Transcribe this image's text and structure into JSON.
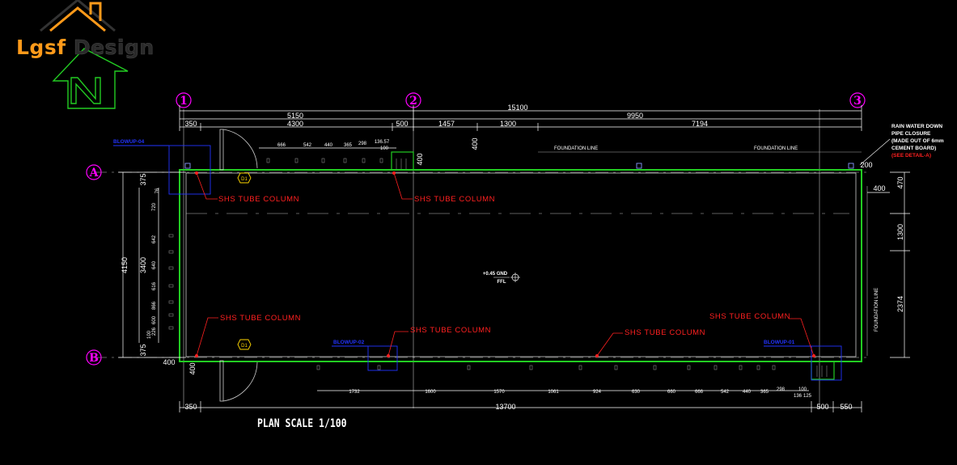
{
  "logo": {
    "word1": "Lgsf",
    "word2": "Design"
  },
  "caption": "PLAN SCALE 1/100",
  "grid_x": [
    "1",
    "2",
    "3"
  ],
  "grid_y": [
    "A",
    "B"
  ],
  "top_dims_row1": [
    "15100"
  ],
  "top_dims_row2": [
    "5150",
    "9950"
  ],
  "top_dims_row3": [
    "350",
    "4300",
    "500",
    "1457",
    "1300",
    "7194"
  ],
  "top_small_dims": [
    "666",
    "542",
    "440",
    "365",
    "298",
    "136.57",
    "100"
  ],
  "bottom_dims": [
    "350",
    "13700",
    "500",
    "550"
  ],
  "bottom_small_dims": [
    "1732",
    "1600",
    "1570",
    "1061",
    "924",
    "630",
    "660",
    "666",
    "542",
    "440",
    "365",
    "298",
    "100",
    "136",
    "125"
  ],
  "left_dims": [
    "4150",
    "3400",
    "375",
    "375",
    "400"
  ],
  "left_small_dims": [
    "720",
    "642",
    "640",
    "616",
    "866",
    "600",
    "100",
    "226",
    "76"
  ],
  "right_dims": [
    "200",
    "400",
    "470",
    "1300",
    "2374"
  ],
  "misc_dims": [
    "400",
    "400"
  ],
  "foundation_line": "FOUNDATION LINE",
  "column_label": "SHS TUBE COLUMN",
  "blowup_labels": [
    "BLOWUP-04",
    "BLOWUP-02",
    "BLOWUP-01"
  ],
  "door_tag": "D1",
  "ffl_label": "+0.45 GND",
  "ffl_sub": "FFL",
  "rainwater_note": [
    "RAIN WATER DOWN",
    "PIPE CLOSURE",
    "(MADE OUT OF 6mm",
    "CEMENT BOARD)"
  ],
  "rainwater_detail": "(SEE DETAIL-A)",
  "colors": {
    "background": "#000000",
    "wall": "#22cc22",
    "dimension": "#ffffff",
    "grid_bubble": "#ff00ff",
    "column_note": "#ff2020",
    "blowup": "#2233ff",
    "door_tag": "#ffd700",
    "logo_orange": "#ff9a1a"
  }
}
